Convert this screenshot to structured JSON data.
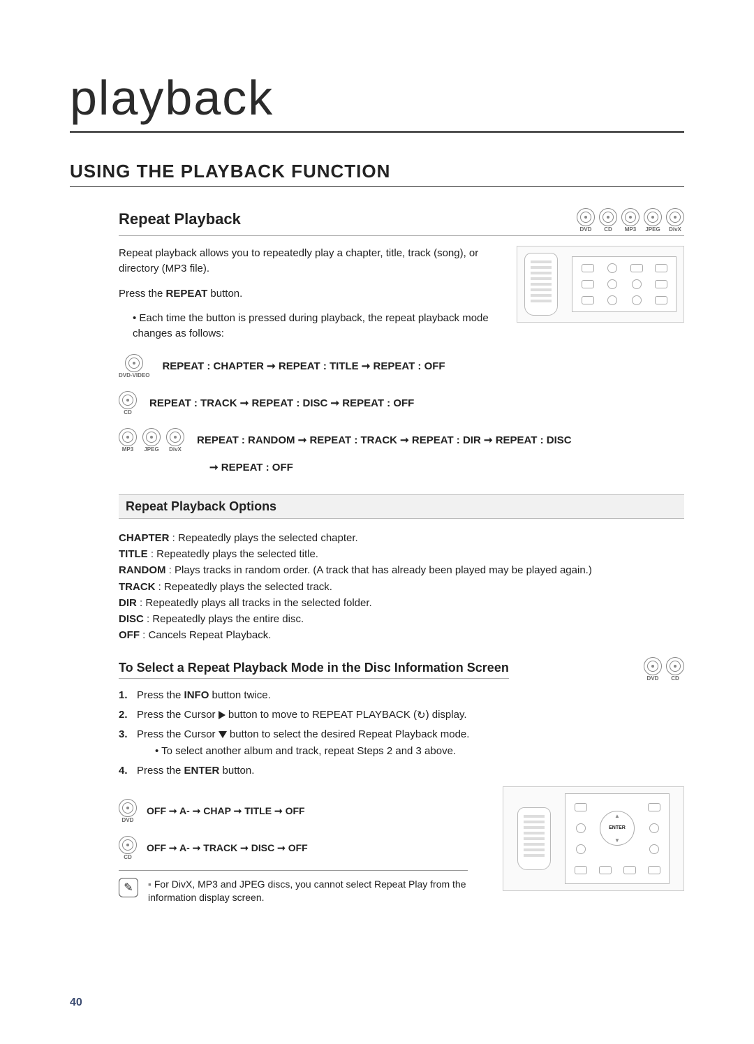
{
  "page_number": "40",
  "chapter_title": "playback",
  "section_heading": "USING THE PLAYBACK FUNCTION",
  "top_media": [
    "DVD",
    "CD",
    "MP3",
    "JPEG",
    "DivX"
  ],
  "repeat": {
    "heading": "Repeat Playback",
    "intro": "Repeat playback allows you to repeatedly play a chapter, title, track (song), or directory (MP3 file).",
    "press_line_prefix": "Press the ",
    "press_line_bold": "REPEAT",
    "press_line_suffix": " button.",
    "mode_info": "Each time the button is pressed during playback, the repeat playback mode changes as follows:"
  },
  "sequences": {
    "dvd_icon": "DVD-VIDEO",
    "dvd_text": "REPEAT : CHAPTER ➞ REPEAT : TITLE ➞ REPEAT : OFF",
    "cd_icon": "CD",
    "cd_text": "REPEAT : TRACK ➞ REPEAT : DISC ➞ REPEAT : OFF",
    "mp3_icons": [
      "MP3",
      "JPEG",
      "DivX"
    ],
    "mp3_text": "REPEAT : RANDOM ➞ REPEAT : TRACK ➞ REPEAT : DIR ➞ REPEAT : DISC",
    "mp3_cont": "➞ REPEAT : OFF"
  },
  "options": {
    "heading": "Repeat Playback Options",
    "chapter": {
      "label": "CHAPTER",
      "text": " : Repeatedly plays the selected chapter."
    },
    "title": {
      "label": "TITLE",
      "text": " : Repeatedly plays the selected title."
    },
    "random": {
      "label": "RANDOM",
      "text": " : Plays tracks in random order. (A track that has already been played may be played again.)"
    },
    "track": {
      "label": "TRACK",
      "text": " : Repeatedly plays the selected track."
    },
    "dir": {
      "label": "DIR",
      "text": " : Repeatedly plays all tracks in the selected folder."
    },
    "disc": {
      "label": "DISC",
      "text": " : Repeatedly plays the entire disc."
    },
    "off": {
      "label": "OFF",
      "text": " : Cancels Repeat Playback."
    }
  },
  "procedure": {
    "heading": "To Select a Repeat Playback Mode in the Disc Information Screen",
    "proc_media": [
      "DVD",
      "CD"
    ],
    "step1_pre": "Press the ",
    "step1_bold": "INFO",
    "step1_post": " button twice.",
    "step2_pre": "Press the Cursor ",
    "step2_mid": " button to move to REPEAT PLAYBACK (",
    "step2_post": ") display.",
    "step3_pre": "Press the Cursor ",
    "step3_post": " button to select the desired Repeat Playback mode.",
    "step3_sub": "To select another album and track, repeat Steps 2 and 3 above.",
    "step4_pre": "Press the ",
    "step4_bold": "ENTER",
    "step4_post": " button."
  },
  "bottom_seq": {
    "dvd_icon": "DVD",
    "dvd_text": "OFF ➞ A- ➞ CHAP ➞ TITLE ➞ OFF",
    "cd_icon": "CD",
    "cd_text": "OFF ➞ A- ➞ TRACK ➞ DISC ➞ OFF"
  },
  "note": "For DivX, MP3 and JPEG discs, you cannot select Repeat Play from the information display screen.",
  "enter_label": "ENTER"
}
